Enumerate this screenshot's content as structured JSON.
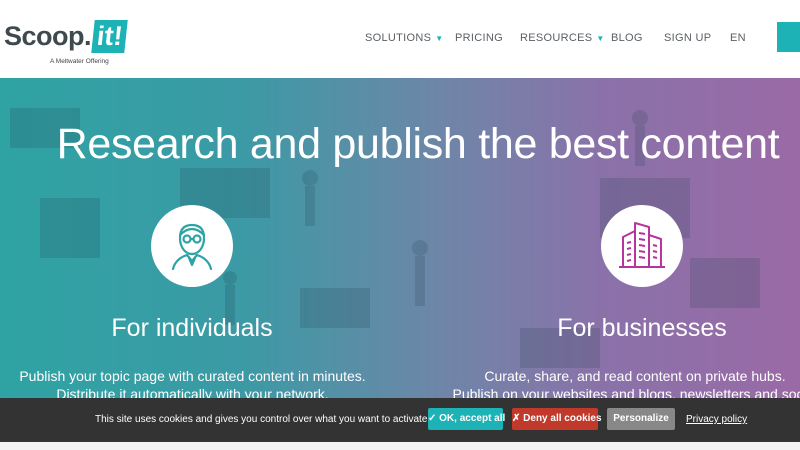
{
  "logo": {
    "word": "Scoop.",
    "box": "it!",
    "tagline": "A Meltwater Offering"
  },
  "nav": {
    "items": [
      {
        "label": "SOLUTIONS",
        "caret": "▼"
      },
      {
        "label": "PRICING"
      },
      {
        "label": "RESOURCES",
        "caret": "▼"
      },
      {
        "label": "BLOG"
      },
      {
        "label": "SIGN UP"
      },
      {
        "label": "EN"
      }
    ]
  },
  "hero": {
    "title": "Research and publish the best content",
    "individuals": {
      "icon": "person-icon",
      "title": "For individuals",
      "line1": "Publish your topic page with curated content in minutes.",
      "line2": "Distribute it automatically with your network."
    },
    "businesses": {
      "icon": "buildings-icon",
      "title": "For businesses",
      "line1": "Curate, share, and read content on private hubs.",
      "line2": "Publish on your websites and blogs, newsletters and social"
    }
  },
  "cookie": {
    "text": "This site uses cookies and gives you control over what you want to activate",
    "accept": "✓ OK, accept all",
    "deny": "✗ Deny all cookies",
    "personalize": "Personalize",
    "privacy": "Privacy policy"
  },
  "colors": {
    "brand": "#1cb2b6",
    "deny": "#c0392b",
    "personalize": "#888888",
    "cookie_bar": "#333333",
    "icon_purple": "#b8339a"
  }
}
